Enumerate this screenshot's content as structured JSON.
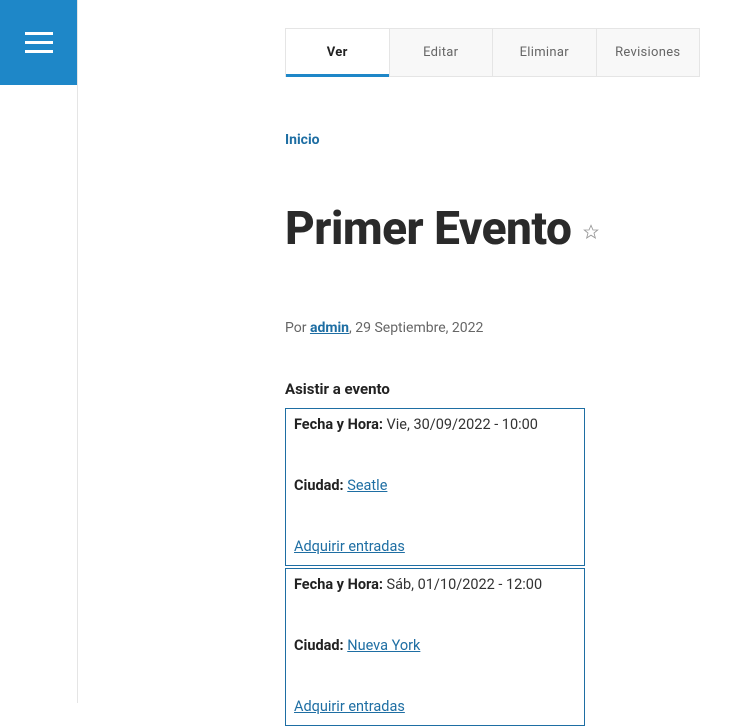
{
  "colors": {
    "accent": "#1e87c8",
    "link": "#1e6ea3"
  },
  "tabs": [
    {
      "label": "Ver",
      "active": true
    },
    {
      "label": "Editar",
      "active": false
    },
    {
      "label": "Eliminar",
      "active": false
    },
    {
      "label": "Revisiones",
      "active": false
    }
  ],
  "breadcrumb": {
    "label": "Inicio"
  },
  "page": {
    "title": "Primer Evento"
  },
  "byline": {
    "prefix": "Por ",
    "author": "admin",
    "separator": ", ",
    "date": "29 Septiembre, 2022"
  },
  "section": {
    "heading": "Asistir a evento"
  },
  "labels": {
    "datetime": "Fecha y Hora:",
    "city": "Ciudad:",
    "acquire": "Adquirir entradas"
  },
  "events": [
    {
      "datetime": "Vie, 30/09/2022 - 10:00",
      "city": "Seatle"
    },
    {
      "datetime": "Sáb, 01/10/2022 - 12:00",
      "city": "Nueva York"
    }
  ]
}
